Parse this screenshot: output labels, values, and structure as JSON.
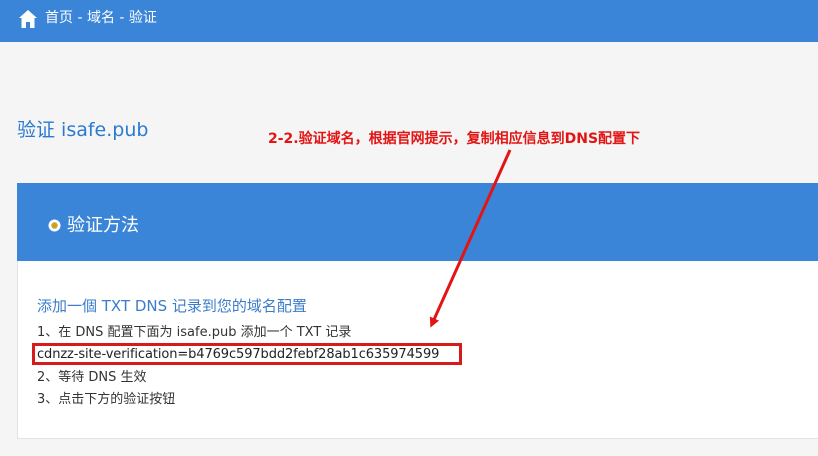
{
  "header": {
    "breadcrumb": "首页 - 域名 - 验证",
    "home_icon": "home-icon"
  },
  "page": {
    "title": "验证 isafe.pub"
  },
  "panel": {
    "title": "验证方法",
    "title_icon": "radio-icon",
    "sub_heading": "添加一個 TXT DNS 记录到您的域名配置",
    "steps": [
      "1、在 DNS 配置下面为 isafe.pub 添加一个 TXT 记录",
      "2、等待 DNS 生效",
      "3、点击下方的验证按钮"
    ],
    "txt_record": "cdnzz-site-verification=b4769c597bdd2febf28ab1c635974599"
  },
  "annotation": {
    "text": "2-2.验证域名，根据官网提示，复制相应信息到DNS配置下",
    "color": "#e21414"
  },
  "colors": {
    "primary": "#3a85d7",
    "title_blue": "#2a7bd0",
    "highlight_red": "#d71b1b"
  }
}
